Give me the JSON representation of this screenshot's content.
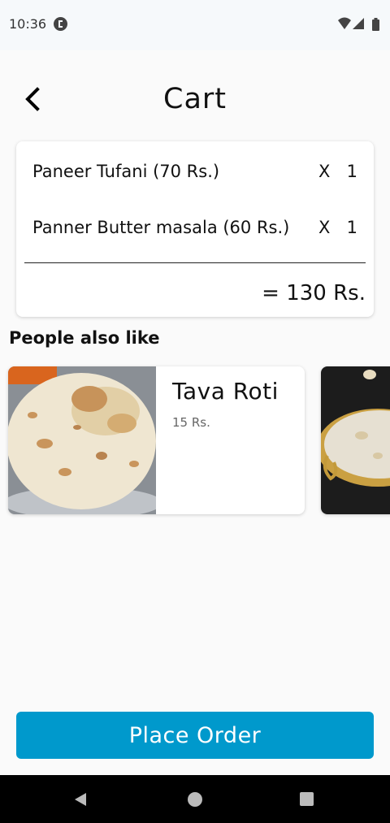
{
  "status_bar": {
    "time": "10:36",
    "icons": [
      "app-notification-icon",
      "wifi-icon",
      "signal-icon",
      "battery-icon"
    ]
  },
  "header": {
    "title": "Cart",
    "back_icon": "back-arrow-icon"
  },
  "cart": {
    "items": [
      {
        "name": "Paneer Tufani (70 Rs.)",
        "times": "X",
        "quantity": "1"
      },
      {
        "name": "Panner Butter masala (60 Rs.)",
        "times": "X",
        "quantity": "1"
      }
    ],
    "total": "= 130 Rs."
  },
  "suggestions": {
    "title": "People also like",
    "items": [
      {
        "name": "Tava Roti",
        "price": "15 Rs.",
        "image": "tava-roti-photo"
      },
      {
        "name": "",
        "price": "",
        "image": "kheer-bowl-photo"
      }
    ]
  },
  "actions": {
    "place_order_label": "Place Order"
  },
  "nav_bar": {
    "icons": [
      "nav-back-icon",
      "nav-home-icon",
      "nav-recents-icon"
    ]
  },
  "colors": {
    "accent": "#0099cc",
    "background": "#fafafa",
    "card": "#ffffff",
    "nav_bar": "#000000"
  }
}
